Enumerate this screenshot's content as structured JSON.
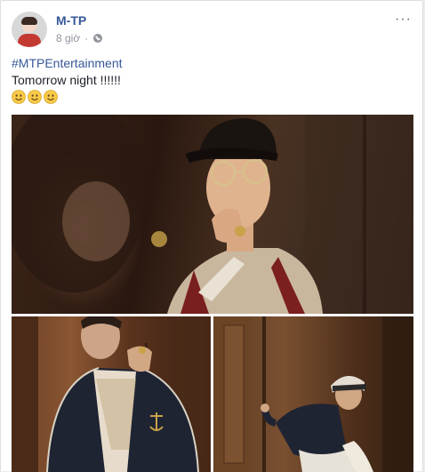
{
  "post": {
    "author": "M-TP",
    "time": "8 giờ",
    "separator": "·",
    "privacy_icon": "globe-icon",
    "more_label": "···",
    "hashtag": "#MTPEntertainment",
    "message": "Tomorrow night !!!!!!",
    "emojis": [
      "smile-emoji",
      "smile-emoji",
      "smile-emoji"
    ]
  },
  "colors": {
    "link": "#365899",
    "text": "#1d2129",
    "meta": "#90949c"
  }
}
